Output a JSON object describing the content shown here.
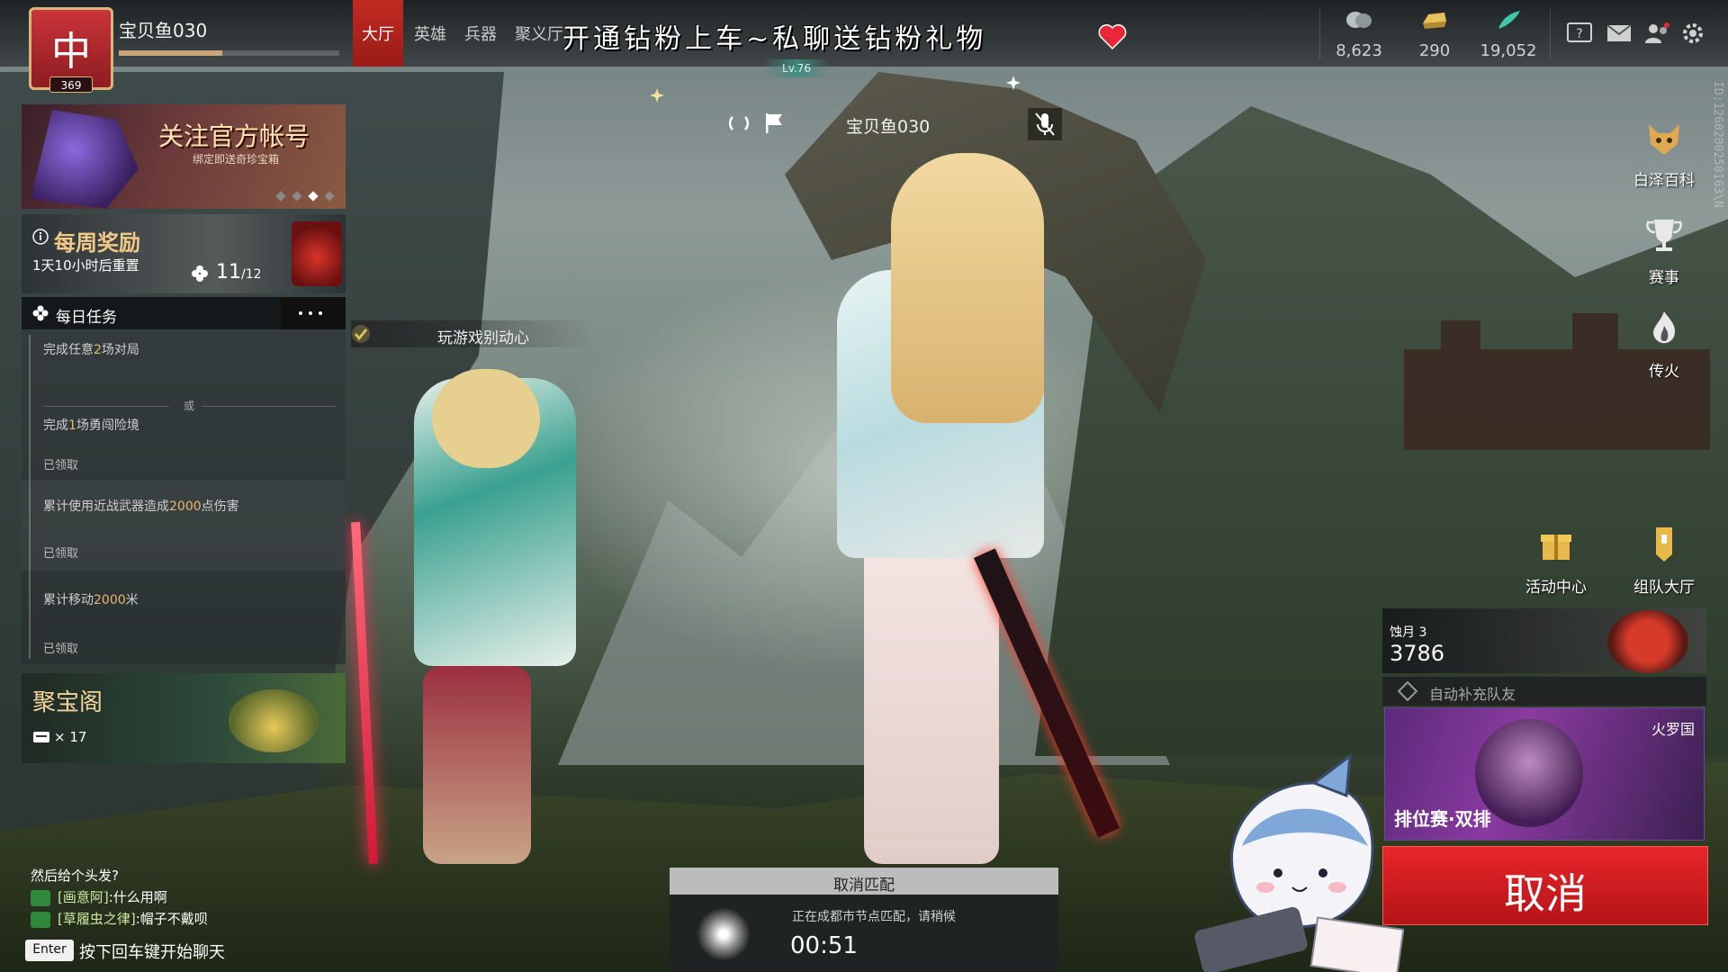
{
  "player": {
    "name": "宝贝鱼030",
    "avatar_glyph": "中",
    "level_number": "369",
    "xp_fraction": 0.47
  },
  "nav": {
    "tabs": [
      {
        "label": "大厅",
        "active": true
      },
      {
        "label": "英雄",
        "active": false
      },
      {
        "label": "兵器",
        "active": false
      },
      {
        "label": "聚义厅",
        "active": false
      }
    ]
  },
  "stream_banner": "开通钻粉上车~私聊送钻粉礼物",
  "currencies": [
    {
      "icon": "coin-icon",
      "amount": "8,623"
    },
    {
      "icon": "gold-ingot-icon",
      "amount": "290"
    },
    {
      "icon": "feather-icon",
      "amount": "19,052"
    }
  ],
  "top_icons": [
    "help-icon",
    "mail-icon",
    "friends-icon",
    "settings-icon"
  ],
  "level_badge": "Lv.76",
  "left_panel": {
    "promo": {
      "title": "关注官方帐号",
      "subtitle": "绑定即送奇珍宝箱",
      "dots": 3,
      "active_dot": 2
    },
    "weekly": {
      "title": "每周奖励",
      "reset_text": "1天10小时后重置",
      "progress": "11",
      "total": "/12"
    },
    "daily": {
      "title": "每日任务",
      "tasks": [
        {
          "prefix": "完成任意",
          "highlight": "2",
          "suffix": "场对局",
          "status": ""
        },
        {
          "prefix": "完成",
          "highlight": "1",
          "suffix": "场勇闯险境",
          "status": "已领取"
        },
        {
          "prefix": "累计使用近战武器造成",
          "highlight": "2000",
          "suffix": "点伤害",
          "status": "已领取"
        },
        {
          "prefix": "累计移动",
          "highlight": "2000",
          "suffix": "米",
          "status": "已领取"
        }
      ],
      "or_label": "或"
    },
    "treasure": {
      "title": "聚宝阁",
      "count": "× 17"
    }
  },
  "mission_tag": "玩游戏别动心",
  "center": {
    "name": "宝贝鱼030"
  },
  "right_rail": [
    {
      "label": "白泽百科",
      "icon": "fox-mask-icon"
    },
    {
      "label": "赛事",
      "icon": "trophy-icon"
    },
    {
      "label": "传火",
      "icon": "flame-icon"
    },
    {
      "label": "活动中心",
      "icon": "gift-box-icon"
    },
    {
      "label": "组队大厅",
      "icon": "banner-icon"
    }
  ],
  "season": {
    "name": "蚀月 3",
    "score": "3786"
  },
  "autofill": {
    "label": "自动补充队友"
  },
  "mode": {
    "map": "火罗国",
    "name": "排位赛·双排"
  },
  "cancel_label": "取消",
  "chat": {
    "lines": [
      {
        "speaker": "",
        "text": "然后给个头发?"
      },
      {
        "speaker": "[画意阿]",
        "text": ":什么用啊"
      },
      {
        "speaker": "[草履虫之律]",
        "text": ":帽子不戴呗"
      }
    ],
    "enter_key": "Enter",
    "hint": "按下回车键开始聊天"
  },
  "match": {
    "cancel_header": "取消匹配",
    "status": "正在成都市节点匹配，请稍候",
    "timer": "00:51"
  },
  "side_id": "ID:1260200250163\\N"
}
